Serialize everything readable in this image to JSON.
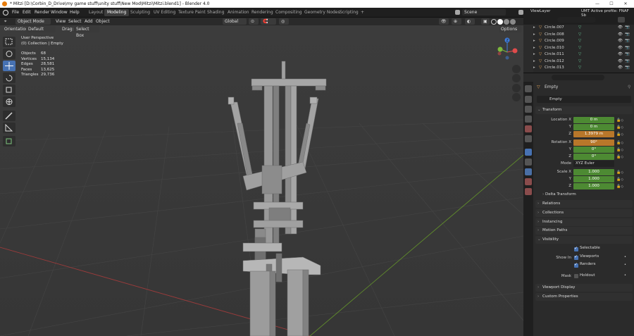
{
  "titlebar": {
    "title": "* Mitzi [D:\\Corbin_D_Drive\\my game stuff\\unity stuff\\New Mod\\Mitzi\\Mitzi.blend1] - Blender 4.0",
    "min": "—",
    "max": "☐",
    "close": "✕"
  },
  "menus": [
    "File",
    "Edit",
    "Render",
    "Window",
    "Help"
  ],
  "workspaces": [
    "Layout",
    "Modeling",
    "Sculpting",
    "UV Editing",
    "Texture Paint",
    "Shading",
    "Animation",
    "Rendering",
    "Compositing",
    "Geometry Nodes",
    "Scripting"
  ],
  "active_workspace": "Modeling",
  "plus": "+",
  "scene": "Scene",
  "view_layer": "ViewLayer",
  "header3d": {
    "mode": "Object Mode",
    "view": "View",
    "select": "Select",
    "add": "Add",
    "object": "Object",
    "transform": "Global",
    "options": "Options"
  },
  "header3d2": {
    "orientation_label": "Orientation:",
    "orientation": "Default",
    "drag_label": "Drag:",
    "drag": "Select Box"
  },
  "viewport_info": {
    "perspective": "User Perspective",
    "collection": "(0) Collection | Empty"
  },
  "stats": [
    {
      "label": "Objects",
      "value": "68"
    },
    {
      "label": "Vertices",
      "value": "15,134"
    },
    {
      "label": "Edges",
      "value": "28,581"
    },
    {
      "label": "Faces",
      "value": "13,625"
    },
    {
      "label": "Triangles",
      "value": "29,736"
    }
  ],
  "gizmo": {
    "x": "X",
    "y": "Y",
    "z": "Z"
  },
  "outliner_header": {
    "profile": "UMT Active profile: FNAF Sb"
  },
  "outliner": [
    "Circle.007",
    "Circle.008",
    "Circle.009",
    "Circle.010",
    "Circle.011",
    "Circle.012",
    "Circle.013"
  ],
  "props": {
    "object_name": "Empty",
    "object_field": "Empty",
    "transform_label": "Transform",
    "location_x_label": "Location X",
    "location_x": "0 m",
    "location_y_label": "Y",
    "location_y": "0 m",
    "location_z_label": "Z",
    "location_z": "1.3979 m",
    "rotation_x_label": "Rotation X",
    "rotation_x": "90°",
    "rotation_y_label": "Y",
    "rotation_y": "0°",
    "rotation_z_label": "Z",
    "rotation_z": "0°",
    "mode_label": "Mode",
    "mode": "XYZ Euler",
    "scale_x_label": "Scale X",
    "scale_x": "1.000",
    "scale_y_label": "Y",
    "scale_y": "1.000",
    "scale_z_label": "Z",
    "scale_z": "1.000",
    "delta_transform": "Delta Transform",
    "relations": "Relations",
    "collections": "Collections",
    "instancing": "Instancing",
    "motion_paths": "Motion Paths",
    "visibility": "Visibility",
    "selectable": "Selectable",
    "show_in_label": "Show In",
    "viewports": "Viewports",
    "renders": "Renders",
    "mask_label": "Mask",
    "holdout": "Holdout",
    "viewport_display": "Viewport Display",
    "custom_properties": "Custom Properties"
  }
}
